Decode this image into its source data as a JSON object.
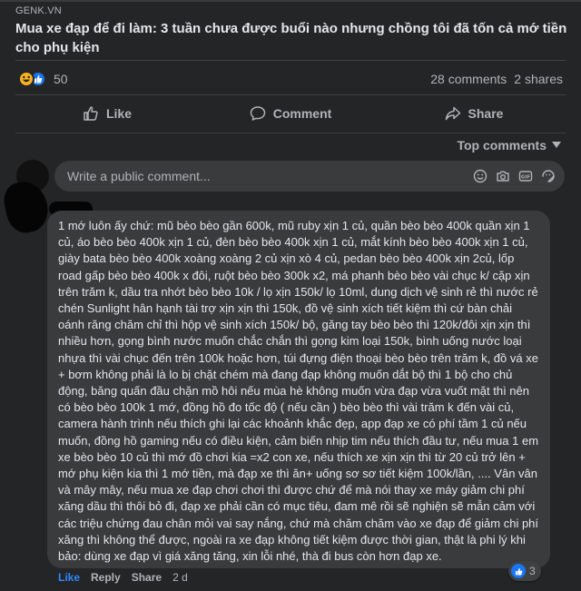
{
  "post": {
    "source": "GENK.VN",
    "title": "Mua xe đạp để đi làm: 3 tuần chưa được buổi nào nhưng chồng tôi đã tốn cả mớ tiền cho phụ kiện"
  },
  "stats": {
    "reaction_count": "50",
    "comments": "28 comments",
    "shares": "2 shares"
  },
  "actions": {
    "like": "Like",
    "comment": "Comment",
    "share": "Share"
  },
  "sort": {
    "label": "Top comments"
  },
  "composer": {
    "placeholder": "Write a public comment..."
  },
  "comment": {
    "text": "1 mớ luôn ấy chứ: mũ bèo bèo gần 600k, mũ ruby xịn 1 củ, quần bèo bèo 400k quần xịn 1 củ, áo bèo bèo 400k xịn 1 củ, đèn bèo bèo 400k xịn 1 củ, mắt kính bèo bèo 400k xịn 1 củ, giày bata bèo bèo 400k xoàng xoàng 2 củ xịn xò 4 củ, pedan bèo bèo 400k xịn 2củ, lốp road gấp bèo bèo 400k x đôi, ruột bèo bèo 300k x2, má phanh bèo bèo vài chục k/ cặp xịn trên trăm k, dầu tra nhớt bèo bèo 10k / lọ xịn 150k/ lọ 10ml, dung dịch vệ sinh rẻ thì nước rẻ chén Sunlight hân hạnh tài trợ xịn xịn thì 150k, đồ vệ sinh xích tiết kiệm thì cứ bàn chải oánh răng chăm chỉ thì hộp vệ sinh xích 150k/ bộ, găng tay bèo bèo thì 120k/đôi xịn xịn thì nhiều hơn, gọng bình nước muốn chắc chắn thì gọng kim loại 150k, bình uống nước loại nhựa thì vài chục đến trên 100k hoặc hơn, túi đựng điện thoại bèo bèo trên trăm k, đồ vá xe + bơm không phải là lo bị chặt chém mà đang đạp không muốn dắt bộ thì 1 bộ cho chủ động, băng quấn đầu chặn mồ hôi nếu mùa hè không muốn vừa đạp vừa vuốt mặt thì nên có bèo bèo 100k 1 mớ, đồng hồ đo tốc độ ( nếu cần ) bèo bèo thì vài trăm k đến vài củ, camera hành trình nếu thích ghi lại các khoảnh khắc đẹp, app đạp xe có phí tầm 1 củ nếu muốn, đồng hồ gaming nếu có điều kiện, cảm biến nhịp tim nếu thích đầu tư, nếu mua 1 em xe bèo bèo 10 củ thì mớ đồ chơi kia =x2 con xe, nếu thích xe xịn xịn thì từ 20 củ trở lên + mớ phụ kiện kia thì 1 mớ tiền, mà đạp xe thì ăn+ uống sơ sơ tiết kiệm 100k/lần, .... Vân vân và mây mây, nếu mua xe đạp chơi chơi thì được chứ để mà nói thay xe máy giảm chi phí xăng dầu thì thôi bỏ đi, đạp xe phải cần có mục tiêu, đam mê rồi sẽ nghiện sẽ mẫn cảm với các triệu chứng đau chân mỏi vai say nắng, chứ mà chăm chăm vào xe đạp để giảm chi phí xăng thì không thể được, ngoài ra xe đạp không tiết kiệm được thời gian, thật là phi lý khi bảo: dùng xe đạp vì giá xăng tăng, xin lỗi nhé, thà đi bus còn hơn đạp xe.",
    "like": "Like",
    "reply": "Reply",
    "share": "Share",
    "time": "2 d",
    "reaction_count": "3"
  },
  "colors": {
    "background": "#242526",
    "bubble": "#3a3b3c",
    "primary_text": "#e4e6eb",
    "secondary_text": "#b0b3b8",
    "like_blue": "#2e89ff",
    "haha_yellow": "#f7b125"
  }
}
